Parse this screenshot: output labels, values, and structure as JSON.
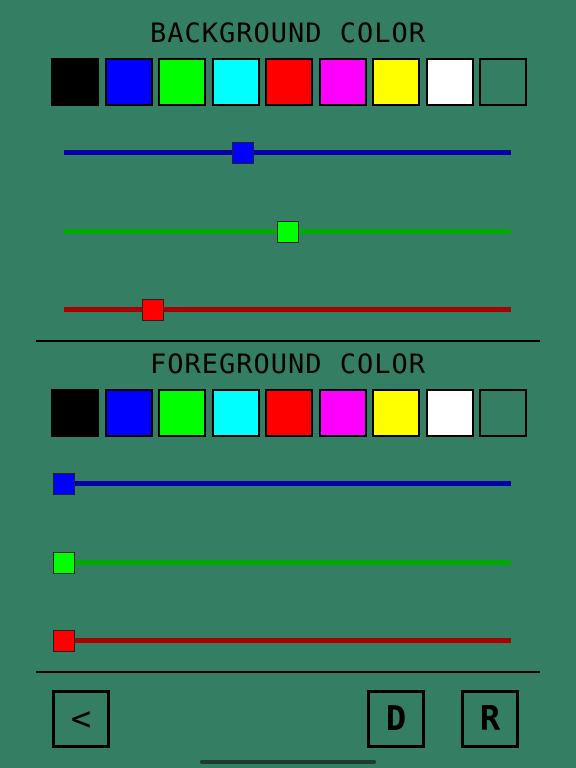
{
  "background": {
    "title": "BACKGROUND COLOR",
    "swatches": [
      "#000000",
      "#0000ff",
      "#00ff00",
      "#00ffff",
      "#ff0000",
      "#ff00ff",
      "#ffff00",
      "#ffffff",
      "#347e63"
    ],
    "sliders": [
      {
        "channel": "blue",
        "track_color": "#0000aa",
        "thumb_color": "#0000ff",
        "value": 0.4
      },
      {
        "channel": "green",
        "track_color": "#00aa00",
        "thumb_color": "#00ff00",
        "value": 0.5
      },
      {
        "channel": "red",
        "track_color": "#aa0000",
        "thumb_color": "#ff0000",
        "value": 0.2
      }
    ]
  },
  "foreground": {
    "title": "FOREGROUND COLOR",
    "swatches": [
      "#000000",
      "#0000ff",
      "#00ff00",
      "#00ffff",
      "#ff0000",
      "#ff00ff",
      "#ffff00",
      "#ffffff",
      "#347e63"
    ],
    "sliders": [
      {
        "channel": "blue",
        "track_color": "#0000aa",
        "thumb_color": "#0000ff",
        "value": 0.0
      },
      {
        "channel": "green",
        "track_color": "#00aa00",
        "thumb_color": "#00ff00",
        "value": 0.0
      },
      {
        "channel": "red",
        "track_color": "#aa0000",
        "thumb_color": "#ff0000",
        "value": 0.0
      }
    ]
  },
  "buttons": {
    "back_label": "<",
    "d_label": "D",
    "r_label": "R"
  },
  "colors": {
    "page_background": "#347e63"
  }
}
